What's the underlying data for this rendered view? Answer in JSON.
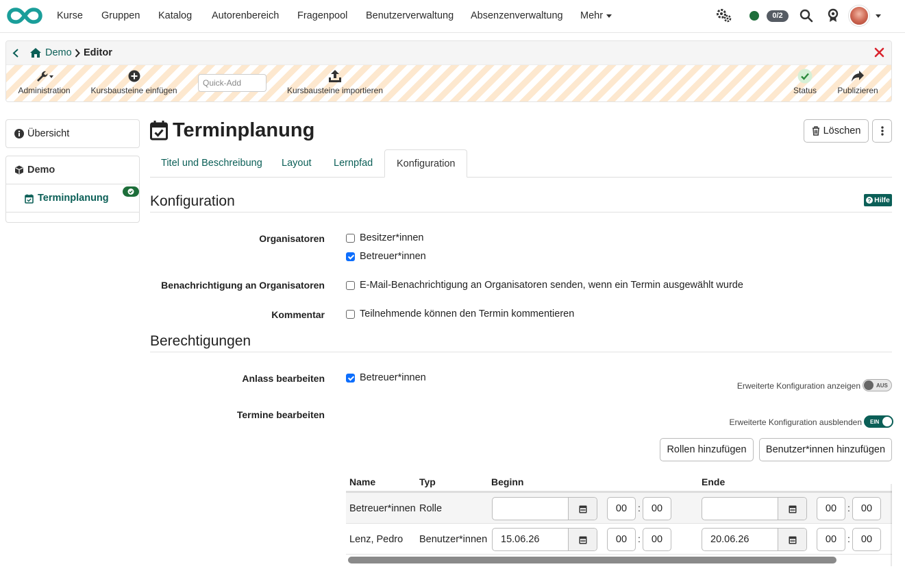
{
  "topnav": {
    "items": [
      "Kurse",
      "Gruppen",
      "Katalog",
      "Autorenbereich",
      "Fragenpool",
      "Benutzerverwaltung",
      "Absenzenverwaltung",
      "Mehr"
    ],
    "session_badge": "0/2",
    "icons": [
      "logo-infinity-icon",
      "gears-icon",
      "online-status-icon",
      "search-icon",
      "badge-icon",
      "avatar",
      "chevron-down-icon"
    ]
  },
  "breadcrumb": {
    "home": "Demo",
    "current": "Editor"
  },
  "toolbar": {
    "administration": "Administration",
    "insert": "Kursbausteine einfügen",
    "quickadd_placeholder": "Quick-Add",
    "import": "Kursbausteine importieren",
    "status": "Status",
    "publish": "Publizieren"
  },
  "sidebar": {
    "overview": "Übersicht",
    "course": "Demo",
    "node": "Terminplanung"
  },
  "main": {
    "title": "Terminplanung",
    "delete_label": "Löschen",
    "tabs": [
      "Titel und Beschreibung",
      "Layout",
      "Lernpfad",
      "Konfiguration"
    ],
    "active_tab": "Konfiguration",
    "help_label": "Hilfe",
    "config": {
      "title": "Konfiguration",
      "organizers_label": "Organisatoren",
      "organizers_opt1": "Besitzer*innen",
      "organizers_opt2": "Betreuer*innen",
      "notify_label": "Benachrichtigung an Organisatoren",
      "notify_opt": "E-Mail-Benachrichtigung an Organisatoren senden, wenn ein Termin ausgewählt wurde",
      "comment_label": "Kommentar",
      "comment_opt": "Teilnehmende können den Termin kommentieren"
    },
    "permissions": {
      "title": "Berechtigungen",
      "edit_event_label": "Anlass bearbeiten",
      "edit_event_opt": "Betreuer*innen",
      "toggle1_label": "Erweiterte Konfiguration anzeigen",
      "toggle1_state": "AUS",
      "edit_dates_label": "Termine bearbeiten",
      "toggle2_label": "Erweiterte Konfiguration ausblenden",
      "toggle2_state": "EIN",
      "add_roles": "Rollen hinzufügen",
      "add_users": "Benutzer*innen hinzufügen",
      "table": {
        "headers": [
          "Name",
          "Typ",
          "Beginn",
          "Ende"
        ],
        "rows": [
          {
            "name": "Betreuer*innen",
            "type": "Rolle",
            "start_date": "",
            "start_h": "00",
            "start_m": "00",
            "end_date": "",
            "end_h": "00",
            "end_m": "00"
          },
          {
            "name": "Lenz, Pedro",
            "type": "Benutzer*innen",
            "start_date": "15.06.26",
            "start_h": "00",
            "start_m": "00",
            "end_date": "20.06.26",
            "end_h": "00",
            "end_m": "00"
          }
        ]
      }
    }
  },
  "colors": {
    "accent": "#0b5f57",
    "brand": "#1a9e9a",
    "checkbox": "#0d6efd",
    "close": "#d9232d"
  }
}
